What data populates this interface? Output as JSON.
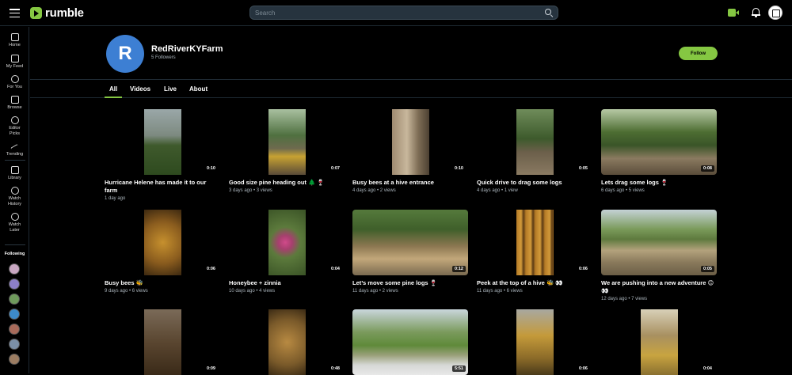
{
  "app": {
    "logo_text": "rumble",
    "brand_color": "#85c742"
  },
  "search": {
    "placeholder": "Search"
  },
  "sidebar": {
    "items": [
      {
        "label": "Home",
        "icon": "home-icon"
      },
      {
        "label": "My Feed",
        "icon": "feed-icon"
      },
      {
        "label": "For You",
        "icon": "for-you-icon"
      },
      {
        "label": "Browse",
        "icon": "browse-icon"
      },
      {
        "label": "Editor Picks",
        "icon": "editor-picks-icon"
      },
      {
        "label": "Trending",
        "icon": "trending-icon"
      },
      {
        "label": "Library",
        "icon": "library-icon"
      },
      {
        "label": "Watch History",
        "icon": "watch-history-icon"
      },
      {
        "label": "Watch Later",
        "icon": "watch-later-icon"
      }
    ],
    "following_title": "Following"
  },
  "channel": {
    "avatar_letter": "R",
    "avatar_color": "#3d7fd3",
    "name": "RedRiverKYFarm",
    "followers": "5 Followers",
    "follow_label": "Follow"
  },
  "tabs": [
    {
      "label": "All",
      "active": true
    },
    {
      "label": "Videos",
      "active": false
    },
    {
      "label": "Live",
      "active": false
    },
    {
      "label": "About",
      "active": false
    }
  ],
  "videos": [
    {
      "title": "Hurricane Helene has made it to our farm",
      "meta": "1 day ago",
      "duration": "0:10"
    },
    {
      "title": "Good size pine heading out 🌲 🍷",
      "meta": "3 days ago • 3 views",
      "duration": "0:07"
    },
    {
      "title": "Busy bees at a hive entrance",
      "meta": "4 days ago • 2 views",
      "duration": "0:10"
    },
    {
      "title": "Quick drive to drag some logs",
      "meta": "4 days ago • 1 view",
      "duration": "0:05"
    },
    {
      "title": "Lets drag some logs 🍷",
      "meta": "6 days ago • 5 views",
      "duration": "0:08"
    },
    {
      "title": "Busy bees 🐝",
      "meta": "9 days ago • 6 views",
      "duration": "0:06"
    },
    {
      "title": "Honeybee + zinnia",
      "meta": "10 days ago • 4 views",
      "duration": "0:04"
    },
    {
      "title": "Let’s move some pine logs 🍷",
      "meta": "11 days ago • 2 views",
      "duration": "0:12"
    },
    {
      "title": "Peek at the top of a hive 🐝 👀",
      "meta": "11 days ago • 6 views",
      "duration": "0:06"
    },
    {
      "title": "We are pushing into a new adventure 😊 👀",
      "meta": "12 days ago • 7 views",
      "duration": "0:05"
    },
    {
      "title": "",
      "meta": "",
      "duration": "0:09"
    },
    {
      "title": "",
      "meta": "",
      "duration": "0:48"
    },
    {
      "title": "",
      "meta": "",
      "duration": "5:51"
    },
    {
      "title": "",
      "meta": "",
      "duration": "0:06"
    },
    {
      "title": "",
      "meta": "",
      "duration": "0:04"
    }
  ]
}
